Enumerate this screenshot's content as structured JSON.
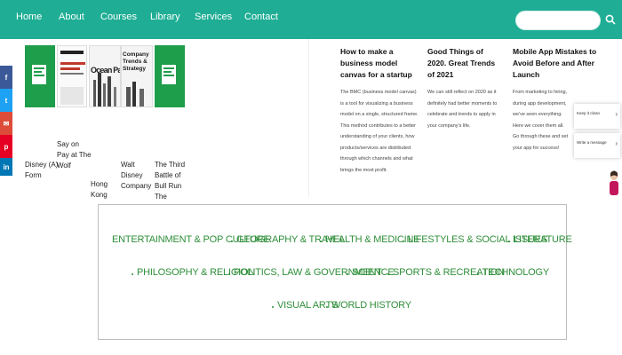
{
  "nav": {
    "items": [
      "Home",
      "About",
      "Courses",
      "Library",
      "Services",
      "Contact"
    ],
    "accent": "#1fae95",
    "search_icon": "search-icon"
  },
  "social": [
    {
      "icon": "facebook-icon",
      "glyph": "f",
      "color": "#3b5998"
    },
    {
      "icon": "twitter-icon",
      "glyph": "t",
      "color": "#1da1f2"
    },
    {
      "icon": "gmail-icon",
      "glyph": "✉",
      "color": "#dd4b39"
    },
    {
      "icon": "pinterest-icon",
      "glyph": "p",
      "color": "#e60023"
    },
    {
      "icon": "linkedin-icon",
      "glyph": "in",
      "color": "#0077b5"
    }
  ],
  "books": [
    {
      "title": "Disney (A) Form",
      "cover_text": ""
    },
    {
      "title": "Say on Pay at The Wolf",
      "cover_text": "Say on Pay at The Wolf"
    },
    {
      "title": "Ocean Park Talk",
      "cover_text": "Ocean Park Tal"
    },
    {
      "title": "Walt Disney Company",
      "cover_text": "Company Trends & Strategy"
    },
    {
      "title": "The Third Battle of Bull Run The",
      "cover_text": ""
    }
  ],
  "book_extra_label": "Hong Kong",
  "posts": [
    {
      "title": "How to make a business model canvas for a startup",
      "text": "The BMC (business model canvas) is a tool for visualizing a business model on a single, structured frame. This method contributes to a better understanding of your clients, how products/services are distributed through which channels and what brings the most profit."
    },
    {
      "title": "Good Things of 2020. Great Trends of 2021",
      "text": "We can still reflect on 2020 as it definitely had better moments to celebrate and trends to apply in your company's life."
    },
    {
      "title": "Mobile App Mistakes to Avoid Before and After Launch",
      "text": "From marketing to hiring, during app development, we've seen everything. Here we cover them all. Go through these and set your app for success!"
    }
  ],
  "side_cards": [
    "Keep it clean",
    "Write a message"
  ],
  "categories": {
    "row1": [
      "Entertainment & Pop Culture",
      "Geography & Travel",
      "Health & Medicine",
      "Lifestyles & Social Issues",
      "Literature"
    ],
    "row2": [
      "Philosophy & Religion",
      "Politics, Law & Government",
      "Science",
      "Sports & Recreation",
      "Technology"
    ],
    "row3": [
      "Visual Arts",
      "World History"
    ]
  }
}
